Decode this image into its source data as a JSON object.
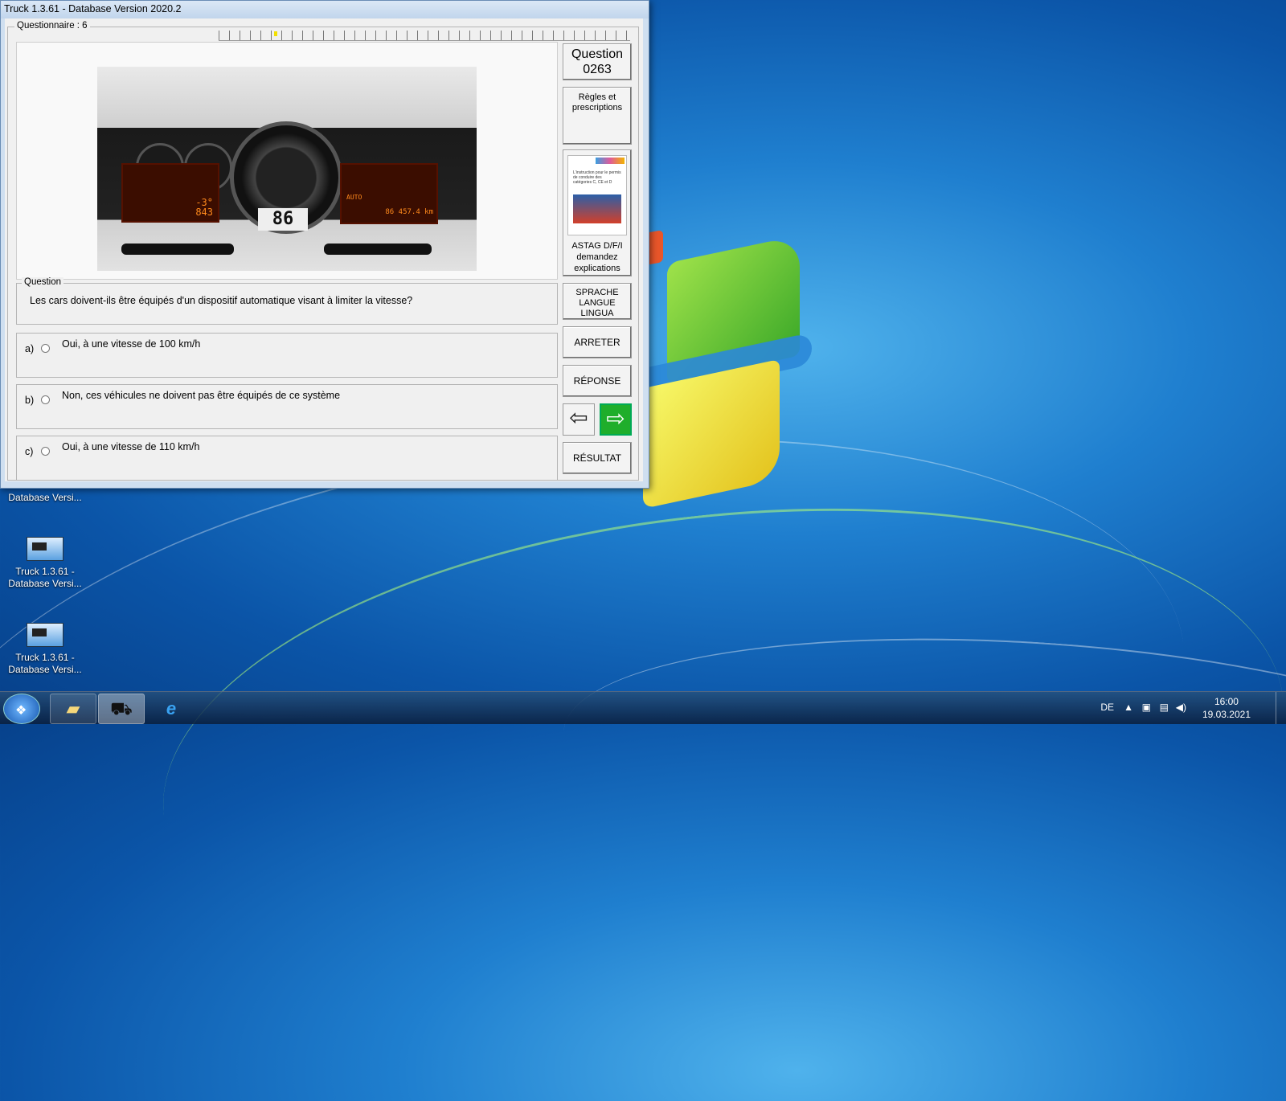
{
  "window": {
    "title": "Truck 1.3.61 - Database Version 2020.2"
  },
  "questionnaire": {
    "label": "Questionnaire : 6"
  },
  "dashboard_image": {
    "lcd_left_1": "-3°",
    "lcd_left_2": "843",
    "digital_speed": "86",
    "lcd_right_1": "AUTO",
    "lcd_right_2": "86 457.4 km"
  },
  "question": {
    "group_label": "Question",
    "text": "Les cars doivent-ils être équipés d'un dispositif automatique visant à limiter la vitesse?"
  },
  "answers": [
    {
      "letter": "a)",
      "text": "Oui,  à une vitesse de 100 km/h"
    },
    {
      "letter": "b)",
      "text": "Non, ces véhicules ne doivent pas être équipés de ce système"
    },
    {
      "letter": "c)",
      "text": "Oui, à une vitesse de 110 km/h"
    }
  ],
  "sidebar": {
    "question_label": "Question",
    "question_number": "0263",
    "rules_line1": "Règles et",
    "rules_line2": "prescriptions",
    "astag_line1": "ASTAG D/F/I",
    "astag_line2": "demandez",
    "astag_line3": "explications",
    "book_text": "L'instruction pour le permis de conduire des catégories C, CE et D",
    "lang_line1": "SPRACHE",
    "lang_line2": "LANGUE",
    "lang_line3": "LINGUA",
    "stop_label": "ARRETER",
    "answer_label": "RÉPONSE",
    "result_label": "RÉSULTAT",
    "prev_icon": "arrow-left-icon",
    "next_icon": "arrow-right-icon"
  },
  "desktop_icons": [
    {
      "line1": "Database Versi..."
    },
    {
      "line1": "Truck 1.3.61 -",
      "line2": "Database Versi..."
    },
    {
      "line1": "Truck 1.3.61 -",
      "line2": "Database Versi..."
    }
  ],
  "taskbar": {
    "language": "DE",
    "time": "16:00",
    "date": "19.03.2021"
  },
  "colors": {
    "next_button": "#1fae2b",
    "desktop_blue": "#1f7fcf"
  }
}
